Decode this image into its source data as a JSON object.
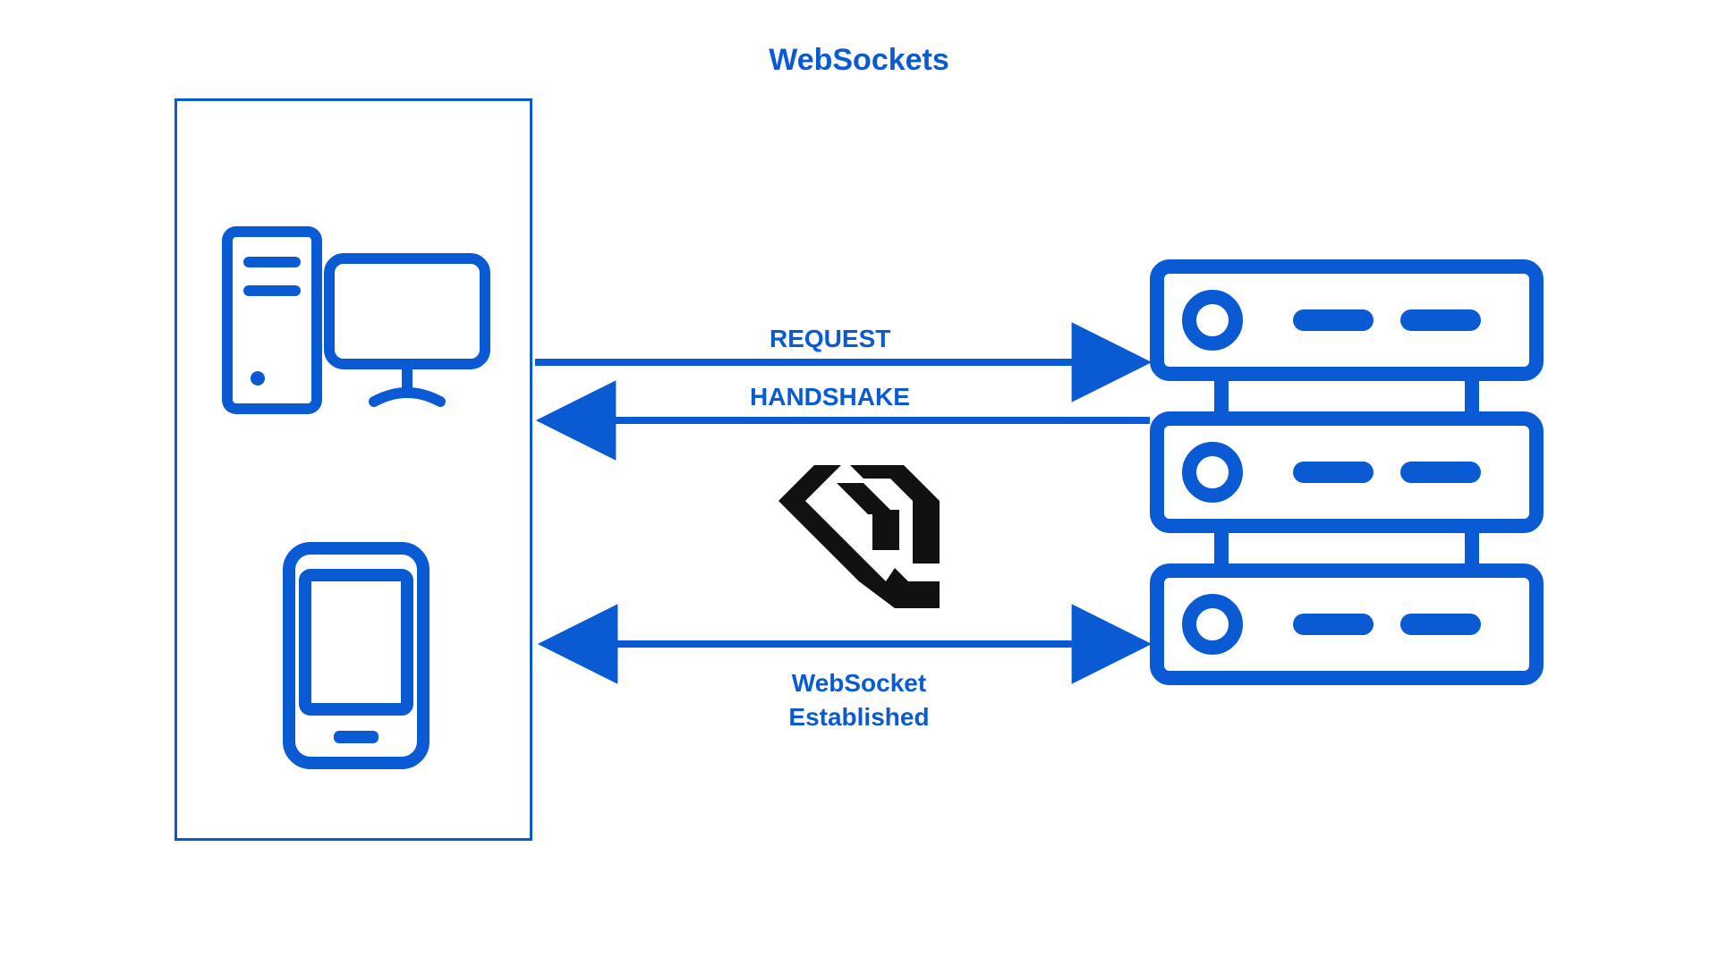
{
  "title": "WebSockets",
  "labels": {
    "request": "REQUEST",
    "handshake": "HANDSHAKE",
    "established_line1": "WebSocket",
    "established_line2": "Established"
  },
  "colors": {
    "primary": "#0a5bd3",
    "logo": "#111111"
  },
  "nodes": {
    "client_devices": [
      "desktop-computer",
      "smartphone"
    ],
    "server": "server-rack"
  },
  "arrows": [
    {
      "name": "request",
      "direction": "right",
      "from": "client",
      "to": "server"
    },
    {
      "name": "handshake",
      "direction": "left",
      "from": "server",
      "to": "client"
    },
    {
      "name": "established",
      "direction": "both",
      "from": "client",
      "to": "server"
    }
  ]
}
